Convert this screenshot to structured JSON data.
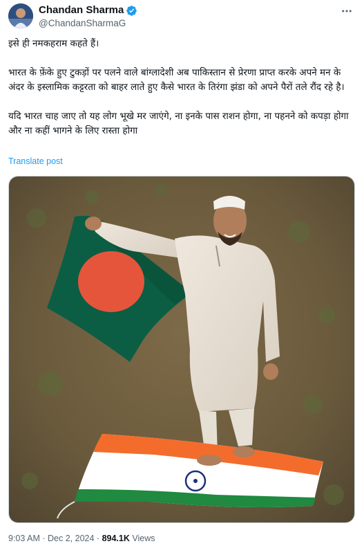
{
  "author": {
    "display_name": "Chandan Sharma",
    "handle": "@ChandanSharmaG",
    "verified": true,
    "verified_color": "#1d9bf0"
  },
  "post": {
    "paragraphs": [
      "इसे ही नमकहराम कहते हैं।",
      "भारत के फ़ेंके हुए टुकड़ों पर पलने वाले बांग्लादेशी अब पाकिस्तान से प्रेरणा प्राप्त करके अपने मन के अंदर के इस्लामिक कट्टरता को बाहर लाते हुए कैसे भारत के तिरंगा झंडा को अपने पैरों तले रौंद रहे है।",
      "यदि भारत चाह जाए तो यह लोग भूखे मर जाएंगे, ना इनके पास राशन होगा, ना पहनने को कपड़ा होगा और ना कहीं भागने के लिए रास्ता होगा"
    ],
    "translate_label": "Translate post",
    "time": "9:03 AM",
    "separator": "·",
    "date": "Dec 2, 2024",
    "views_count": "894.1K",
    "views_label": "Views"
  },
  "icons": {
    "more": "more-horizontal-icon",
    "verified": "verified-badge-icon"
  },
  "colors": {
    "text": "#0f1419",
    "secondary": "#536471",
    "link": "#1d9bf0"
  }
}
